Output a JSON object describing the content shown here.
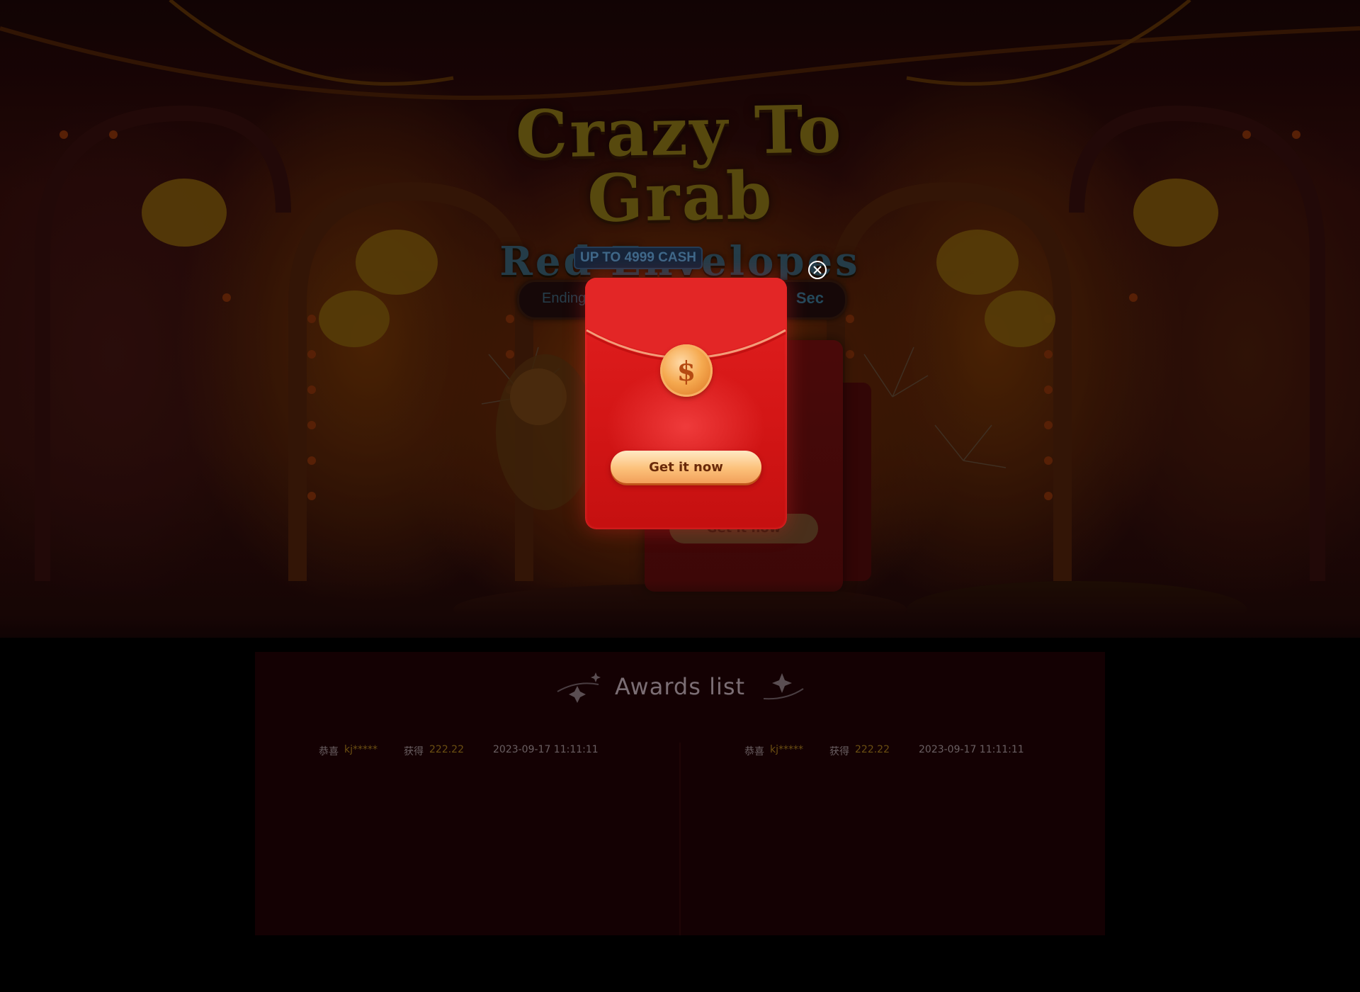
{
  "hero": {
    "title_line1": "Crazy To Grab",
    "title_line2": "Red Envelopes",
    "cash_badge": "UP TO 4999 CASH",
    "countdown_label": "Ending",
    "countdown_unit": "Sec"
  },
  "modal": {
    "coin_symbol": "$",
    "get_button": "Get it now",
    "close_icon": "close-circle-icon"
  },
  "background_envelope": {
    "button_label": "Get it now"
  },
  "awards": {
    "title": "Awards list",
    "rows": [
      {
        "congrats": "恭喜",
        "user": "kj*****",
        "won": "获得",
        "amount": "222.22",
        "time": "2023-09-17 11:11:11"
      },
      {
        "congrats": "恭喜",
        "user": "kj*****",
        "won": "获得",
        "amount": "222.22",
        "time": "2023-09-17 11:11:11"
      }
    ]
  },
  "colors": {
    "envelope_red": "#d41616",
    "button_gold": "#fcc17a",
    "highlight_text": "#6b4f12",
    "awards_bg": "#140103"
  }
}
